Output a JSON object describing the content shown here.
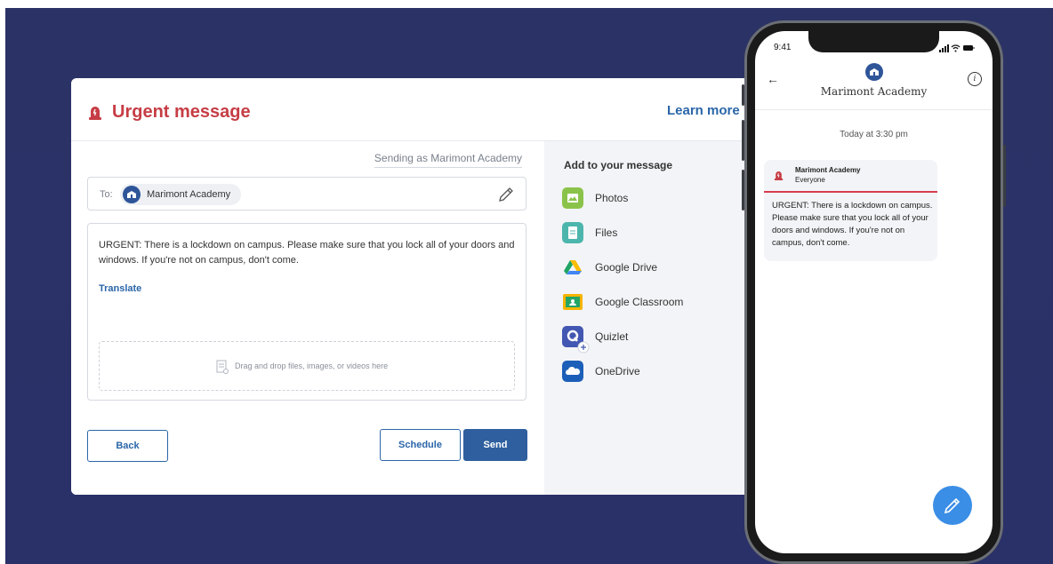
{
  "desktop": {
    "header": {
      "title": "Urgent message",
      "learn_more": "Learn more"
    },
    "compose": {
      "sending_as": "Sending as Marimont Academy",
      "to_label": "To:",
      "recipient": "Marimont Academy",
      "message": "URGENT: There is a lockdown on campus. Please make sure that you lock all of your doors and windows. If you're not on campus, don't come.",
      "translate": "Translate",
      "drop_placeholder": "Drag and drop files, images, or videos here"
    },
    "buttons": {
      "back": "Back",
      "schedule": "Schedule",
      "send": "Send"
    },
    "attachments": {
      "title": "Add to your message",
      "items": [
        {
          "label": "Photos",
          "icon": "photos-icon",
          "color": "#8bc34a"
        },
        {
          "label": "Files",
          "icon": "files-icon",
          "color": "#4db6ac"
        },
        {
          "label": "Google Drive",
          "icon": "google-drive-icon",
          "color": "#fbbc04"
        },
        {
          "label": "Google Classroom",
          "icon": "google-classroom-icon",
          "color": "#f6b400"
        },
        {
          "label": "Quizlet",
          "icon": "quizlet-icon",
          "color": "#4257b2"
        },
        {
          "label": "OneDrive",
          "icon": "onedrive-icon",
          "color": "#1c5fb8"
        }
      ]
    }
  },
  "phone": {
    "time": "9:41",
    "school_name": "Marimont Academy",
    "date_label": "Today at 3:30 pm",
    "bubble": {
      "sender": "Marimont Academy",
      "audience": "Everyone",
      "text": "URGENT: There is a lockdown on campus. Please make sure that you lock all of your doors and windows. If you're not on campus, don't come."
    }
  },
  "colors": {
    "background": "#2b3366",
    "urgent": "#c63d45",
    "accent": "#2a66a8",
    "send": "#2f5f9e",
    "fab": "#3a8ee6"
  }
}
